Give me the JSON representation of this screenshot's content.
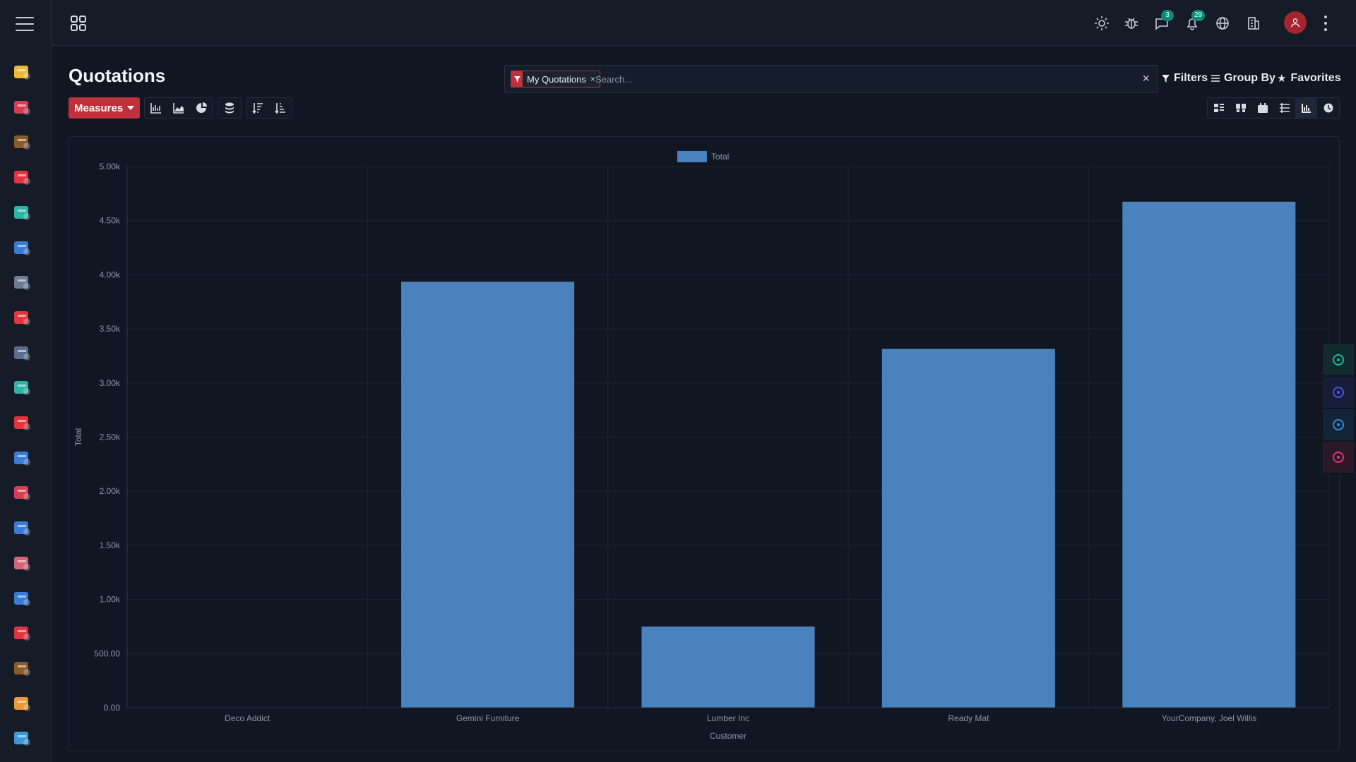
{
  "sidebar": {
    "menu_icon": "hamburger-menu-icon",
    "apps": [
      {
        "name": "discuss-app-icon",
        "color": "#e8b93a"
      },
      {
        "name": "calendar-app-icon",
        "color": "#d23f52"
      },
      {
        "name": "contacts-app-icon",
        "color": "#8a5a2b"
      },
      {
        "name": "crm-app-icon",
        "color": "#e0353f"
      },
      {
        "name": "sales-app-icon",
        "color": "#2fb4a4"
      },
      {
        "name": "pos-app-icon",
        "color": "#3a7bd5"
      },
      {
        "name": "invoicing-app-icon",
        "color": "#6b7c93"
      },
      {
        "name": "project-app-icon",
        "color": "#e0353f"
      },
      {
        "name": "timesheet-app-icon",
        "color": "#5a6d8a"
      },
      {
        "name": "expenses-app-icon",
        "color": "#2fb4a4"
      },
      {
        "name": "purchase-app-icon",
        "color": "#e0353f"
      },
      {
        "name": "manufacturing-app-icon",
        "color": "#3a7bd5"
      },
      {
        "name": "inventory-app-icon",
        "color": "#d23f52"
      },
      {
        "name": "settings-tools-app-icon",
        "color": "#3a7bd5"
      },
      {
        "name": "employees-app-icon",
        "color": "#d2657a"
      },
      {
        "name": "fleet-app-icon",
        "color": "#3a7bd5"
      },
      {
        "name": "time-off-app-icon",
        "color": "#e0353f"
      },
      {
        "name": "wallet-app-icon",
        "color": "#8a5a2b"
      },
      {
        "name": "members-app-icon",
        "color": "#e89a3a"
      },
      {
        "name": "chat-app-icon",
        "color": "#3a9ad5"
      }
    ]
  },
  "topbar": {
    "apps_icon": "apps-grid-icon",
    "theme_icon": "sun-icon",
    "debug_icon": "bug-icon",
    "messages_badge": "3",
    "notifications_badge": "29",
    "language_icon": "globe-icon",
    "company_icon": "building-icon",
    "user_icon": "user-icon",
    "more_icon": "kebab-menu-icon"
  },
  "control_panel": {
    "title": "Quotations",
    "search": {
      "facet_label": "My Quotations",
      "facet_remove": "×",
      "placeholder": "Search...",
      "clear": "×"
    },
    "filters_label": "Filters",
    "group_by_label": "Group By",
    "favorites_label": "Favorites",
    "measures_label": "Measures",
    "chart_tools": [
      "bar-chart-icon",
      "line-chart-icon",
      "pie-chart-icon",
      "stacked-icon",
      "sort-descending-icon",
      "sort-ascending-icon"
    ],
    "views": [
      "kanban-view-icon",
      "list-view-icon",
      "calendar-view-icon",
      "pivot-view-icon",
      "graph-view-icon",
      "activity-view-icon"
    ],
    "active_view": "graph-view-icon"
  },
  "chart_data": {
    "type": "bar",
    "categories": [
      "Deco Addict",
      "Gemini Furniture",
      "Lumber Inc",
      "Ready Mat",
      "YourCompany, Joel Willis"
    ],
    "series": [
      {
        "name": "Total",
        "values": [
          0,
          3935,
          750,
          3315,
          4675
        ],
        "color": "#4a82bd"
      }
    ],
    "xlabel": "Customer",
    "ylabel": "Total",
    "ylim": [
      0,
      5000
    ],
    "yticks": [
      "0.00",
      "500.00",
      "1.00k",
      "1.50k",
      "2.00k",
      "2.50k",
      "3.00k",
      "3.50k",
      "4.00k",
      "4.50k",
      "5.00k"
    ],
    "legend_position": "top-center",
    "grid": true
  },
  "float_tools": [
    {
      "name": "zoom-in-icon",
      "color": "#1fb89a"
    },
    {
      "name": "fullscreen-icon",
      "color": "#4a56e0"
    },
    {
      "name": "gear-icon",
      "color": "#2f8ae0"
    },
    {
      "name": "palette-icon",
      "color": "#e0356a"
    }
  ]
}
